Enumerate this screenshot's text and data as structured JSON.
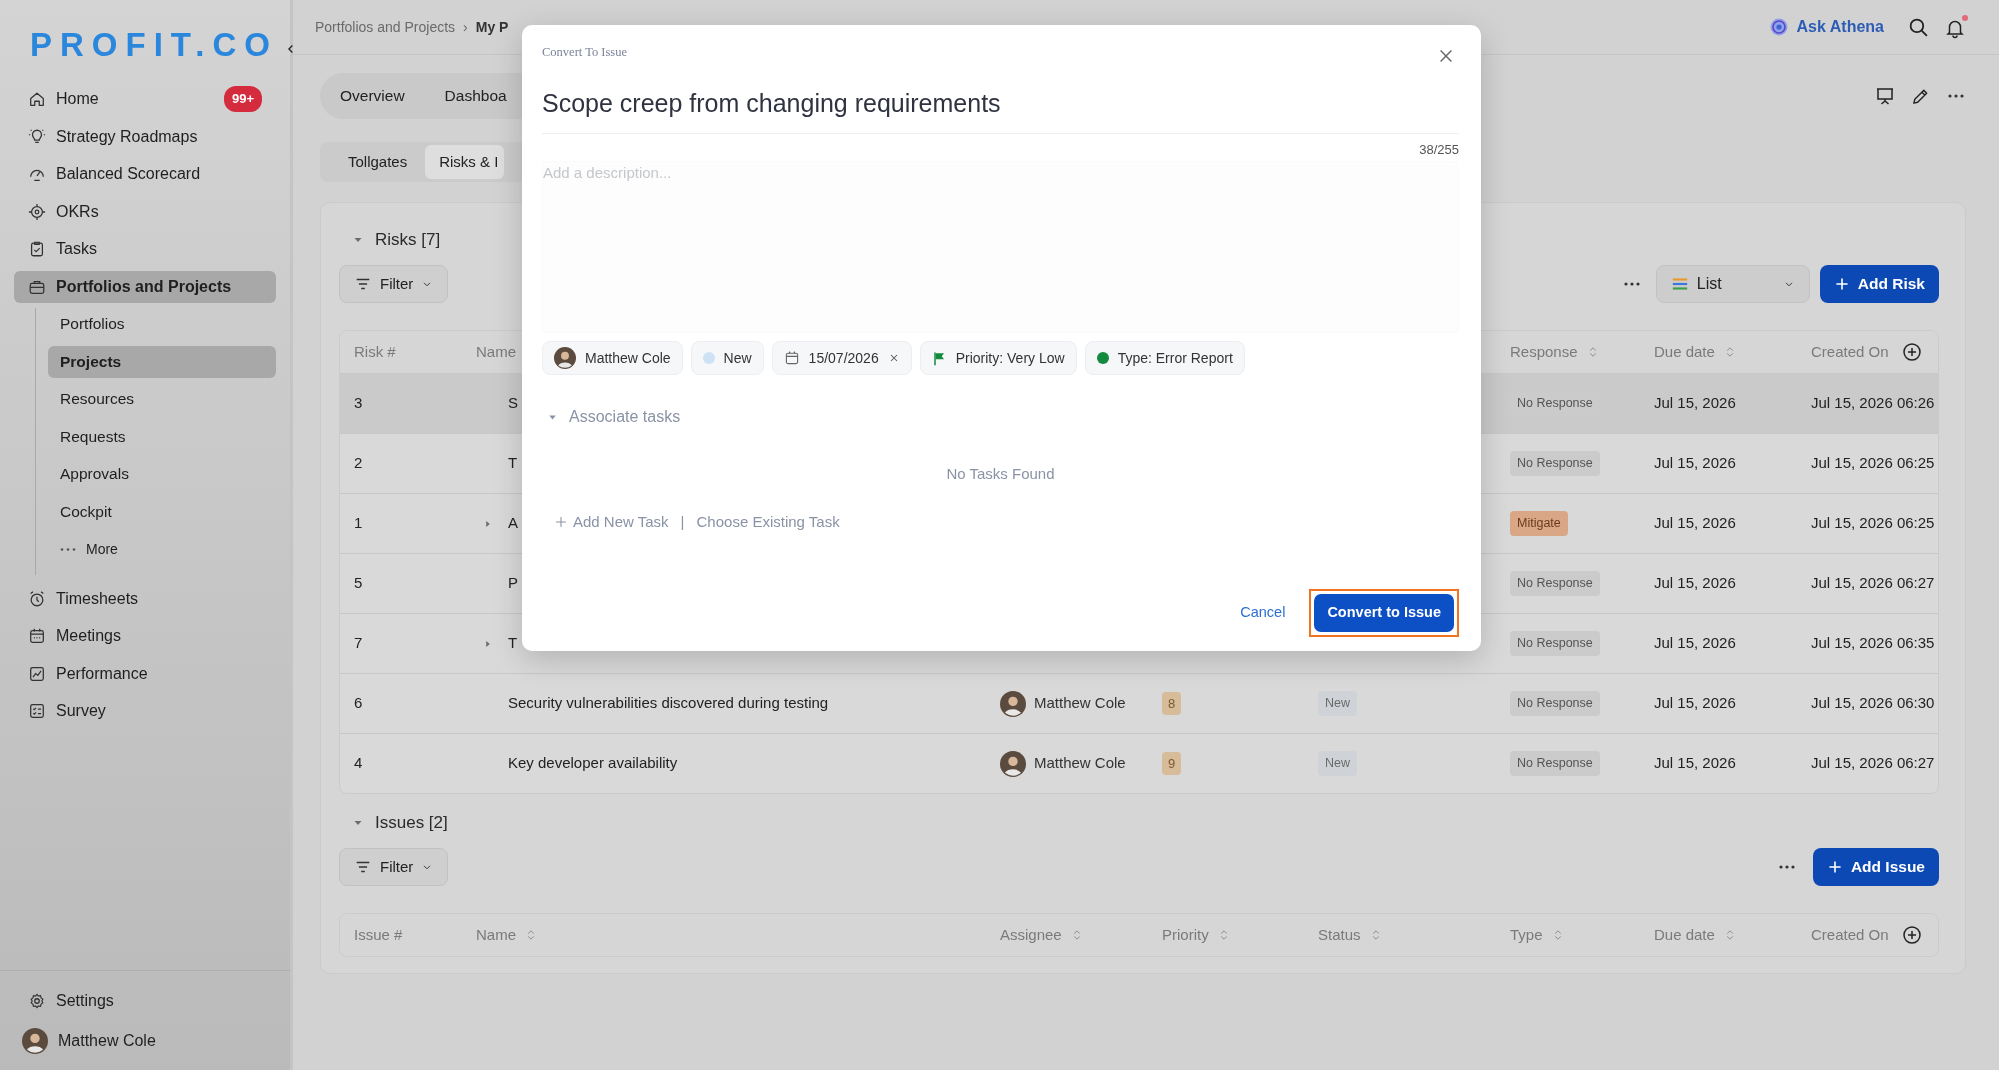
{
  "sidebar": {
    "logo": "PROFIT.CO",
    "items": [
      {
        "label": "Home",
        "badge": "99+",
        "selected": false
      },
      {
        "label": "Strategy Roadmaps",
        "selected": false
      },
      {
        "label": "Balanced Scorecard",
        "selected": false
      },
      {
        "label": "OKRs",
        "selected": false
      },
      {
        "label": "Tasks",
        "selected": false
      },
      {
        "label": "Portfolios and Projects",
        "selected": true,
        "expanded": true,
        "children": [
          {
            "label": "Portfolios",
            "selected": false
          },
          {
            "label": "Projects",
            "selected": true
          },
          {
            "label": "Resources",
            "selected": false
          },
          {
            "label": "Requests",
            "selected": false
          },
          {
            "label": "Approvals",
            "selected": false
          },
          {
            "label": "Cockpit",
            "selected": false
          },
          {
            "label": "More",
            "kind": "more",
            "selected": false
          }
        ]
      },
      {
        "label": "Timesheets",
        "selected": false
      },
      {
        "label": "Meetings",
        "selected": false
      },
      {
        "label": "Performance",
        "selected": false
      },
      {
        "label": "Survey",
        "selected": false
      }
    ],
    "footer": [
      {
        "kind": "settings",
        "label": "Settings"
      },
      {
        "kind": "user",
        "label": "Matthew Cole"
      }
    ]
  },
  "header": {
    "breadcrumb": [
      "Portfolios and Projects",
      "My P"
    ],
    "breadcrumb_separator": "›",
    "assistant": "Ask Athena",
    "unread": true
  },
  "tabs": [
    {
      "label": "Overview",
      "selected": false
    },
    {
      "label": "Dashboa",
      "selected": false
    }
  ],
  "subtabs": [
    {
      "label": "Tollgates",
      "selected": false
    },
    {
      "label": "Risks & I",
      "selected": true
    }
  ],
  "risks": {
    "title": "Risks [7]",
    "expanded": true,
    "filter": "Filter",
    "view": "List",
    "add": "Add Risk",
    "columns": [
      {
        "kind": "number",
        "label": "Risk #",
        "sortable": false
      },
      {
        "kind": "name",
        "label": "Name",
        "sortable": false
      },
      {
        "kind": "response",
        "label": "Response",
        "sortable": true
      },
      {
        "kind": "due",
        "label": "Due date",
        "sortable": true
      },
      {
        "kind": "created",
        "label": "Created On",
        "sortable": false
      }
    ],
    "rows": [
      {
        "number": "3",
        "name": "S",
        "expandable": false,
        "selected": true,
        "response": {
          "text": "No Response",
          "kind": "none"
        },
        "due": "Jul 15, 2026",
        "created": "Jul 15, 2026 06:26"
      },
      {
        "number": "2",
        "name": "T",
        "expandable": false,
        "selected": false,
        "response": {
          "text": "No Response",
          "kind": "none"
        },
        "due": "Jul 15, 2026",
        "created": "Jul 15, 2026 06:25"
      },
      {
        "number": "1",
        "name": "A",
        "expandable": true,
        "selected": false,
        "response": {
          "text": "Mitigate",
          "kind": "mitigate"
        },
        "due": "Jul 15, 2026",
        "created": "Jul 15, 2026 06:25"
      },
      {
        "number": "5",
        "name": "P",
        "expandable": false,
        "selected": false,
        "response": {
          "text": "No Response",
          "kind": "none"
        },
        "due": "Jul 15, 2026",
        "created": "Jul 15, 2026 06:27"
      },
      {
        "number": "7",
        "name": "T",
        "expandable": true,
        "selected": false,
        "response": {
          "text": "No Response",
          "kind": "none"
        },
        "due": "Jul 15, 2026",
        "created": "Jul 15, 2026 06:35"
      },
      {
        "number": "6",
        "name": "Security vulnerabilities discovered during testing",
        "expandable": false,
        "selected": false,
        "assignee": "Matthew Cole",
        "priority": "8",
        "status": "New",
        "response": {
          "text": "No Response",
          "kind": "none"
        },
        "due": "Jul 15, 2026",
        "created": "Jul 15, 2026 06:30"
      },
      {
        "number": "4",
        "name": "Key developer availability",
        "expandable": false,
        "selected": false,
        "assignee": "Matthew Cole",
        "priority": "9",
        "status": "New",
        "response": {
          "text": "No Response",
          "kind": "none"
        },
        "due": "Jul 15, 2026",
        "created": "Jul 15, 2026 06:27"
      }
    ]
  },
  "issues": {
    "title": "Issues [2]",
    "expanded": true,
    "filter": "Filter",
    "add": "Add Issue",
    "columns": [
      {
        "kind": "number",
        "label": "Issue #",
        "sortable": false
      },
      {
        "kind": "name",
        "label": "Name",
        "sortable": true
      },
      {
        "kind": "assignee",
        "label": "Assignee",
        "sortable": true
      },
      {
        "kind": "priority",
        "label": "Priority",
        "sortable": true
      },
      {
        "kind": "status",
        "label": "Status",
        "sortable": true
      },
      {
        "kind": "response",
        "label": "Type",
        "sortable": true
      },
      {
        "kind": "due",
        "label": "Due date",
        "sortable": true
      },
      {
        "kind": "created",
        "label": "Created On",
        "sortable": false
      }
    ]
  },
  "dialog": {
    "title": "Convert To Issue",
    "name": "Scope creep from changing requirements",
    "counter": "38/255",
    "description_placeholder": "Add a description...",
    "chips": [
      {
        "kind": "assignee",
        "label": "Matthew Cole"
      },
      {
        "kind": "status",
        "label": "New",
        "color": "#cfe1f5"
      },
      {
        "kind": "date",
        "label": "15/07/2026"
      },
      {
        "kind": "priority",
        "label": "Priority: Very Low"
      },
      {
        "kind": "type",
        "label": "Type: Error Report",
        "color": "#138a3e"
      }
    ],
    "associate": {
      "title": "Associate tasks",
      "expanded": true,
      "empty": "No Tasks Found",
      "add_new": "Add New Task",
      "separator": "|",
      "choose": "Choose Existing Task"
    },
    "cancel": "Cancel",
    "submit": {
      "label": "Convert to Issue",
      "highlighted": true
    }
  }
}
